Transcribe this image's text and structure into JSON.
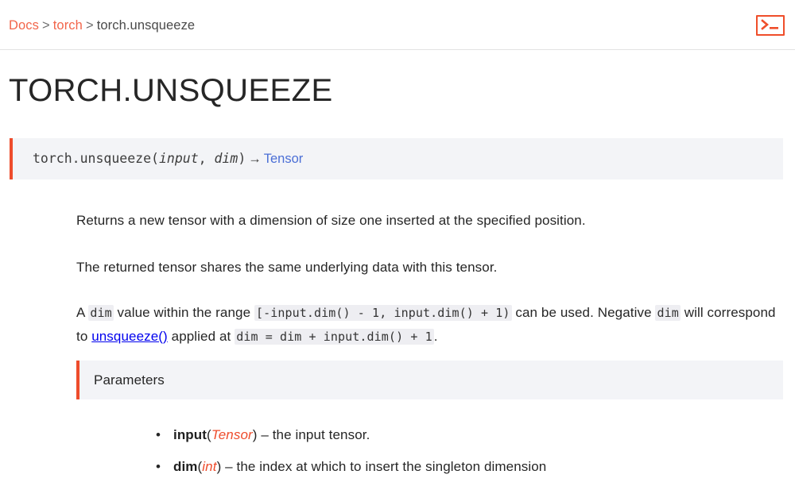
{
  "header": {
    "breadcrumb": {
      "docs_label": "Docs",
      "sep1": ">",
      "torch_label": "torch",
      "sep2": ">",
      "current_label": "torch.unsqueeze"
    },
    "shell_icon_name": "terminal-icon"
  },
  "page": {
    "title": "TORCH.UNSQUEEZE"
  },
  "signature": {
    "name": "torch.unsqueeze",
    "open_paren": "(",
    "param1": "input",
    "comma": ", ",
    "param2": "dim",
    "close_paren": ")",
    "arrow": "→",
    "return_type": "Tensor"
  },
  "body": {
    "p1": "Returns a new tensor with a dimension of size one inserted at the specified position.",
    "p2": "The returned tensor shares the same underlying data with this tensor.",
    "p3": {
      "t1": "A ",
      "c1": "dim",
      "t2": " value within the range ",
      "c2": "[-input.dim() - 1, input.dim() + 1)",
      "t3": " can be used. Negative ",
      "c3": "dim",
      "t4": " will correspond to ",
      "c4": "unsqueeze()",
      "t5": " applied at ",
      "c5": "dim = dim + input.dim() + 1",
      "t6": "."
    }
  },
  "parameters": {
    "heading": "Parameters",
    "items": [
      {
        "bullet": "•",
        "name": "input",
        "open_paren": "(",
        "type": "Tensor",
        "close_paren": ")",
        "dash": " – ",
        "description": "the input tensor."
      },
      {
        "bullet": "•",
        "name": "dim",
        "open_paren": "(",
        "type": "int",
        "close_paren": ")",
        "dash": " – ",
        "description": "the index at which to insert the singleton dimension"
      }
    ]
  },
  "colors": {
    "accent": "#ee4c2c",
    "breadcrumb_link": "#f2654a",
    "code_link": "#4b6fd6",
    "block_bg": "#f3f4f7",
    "inline_code_bg": "#eeeef2",
    "text": "#262626"
  }
}
